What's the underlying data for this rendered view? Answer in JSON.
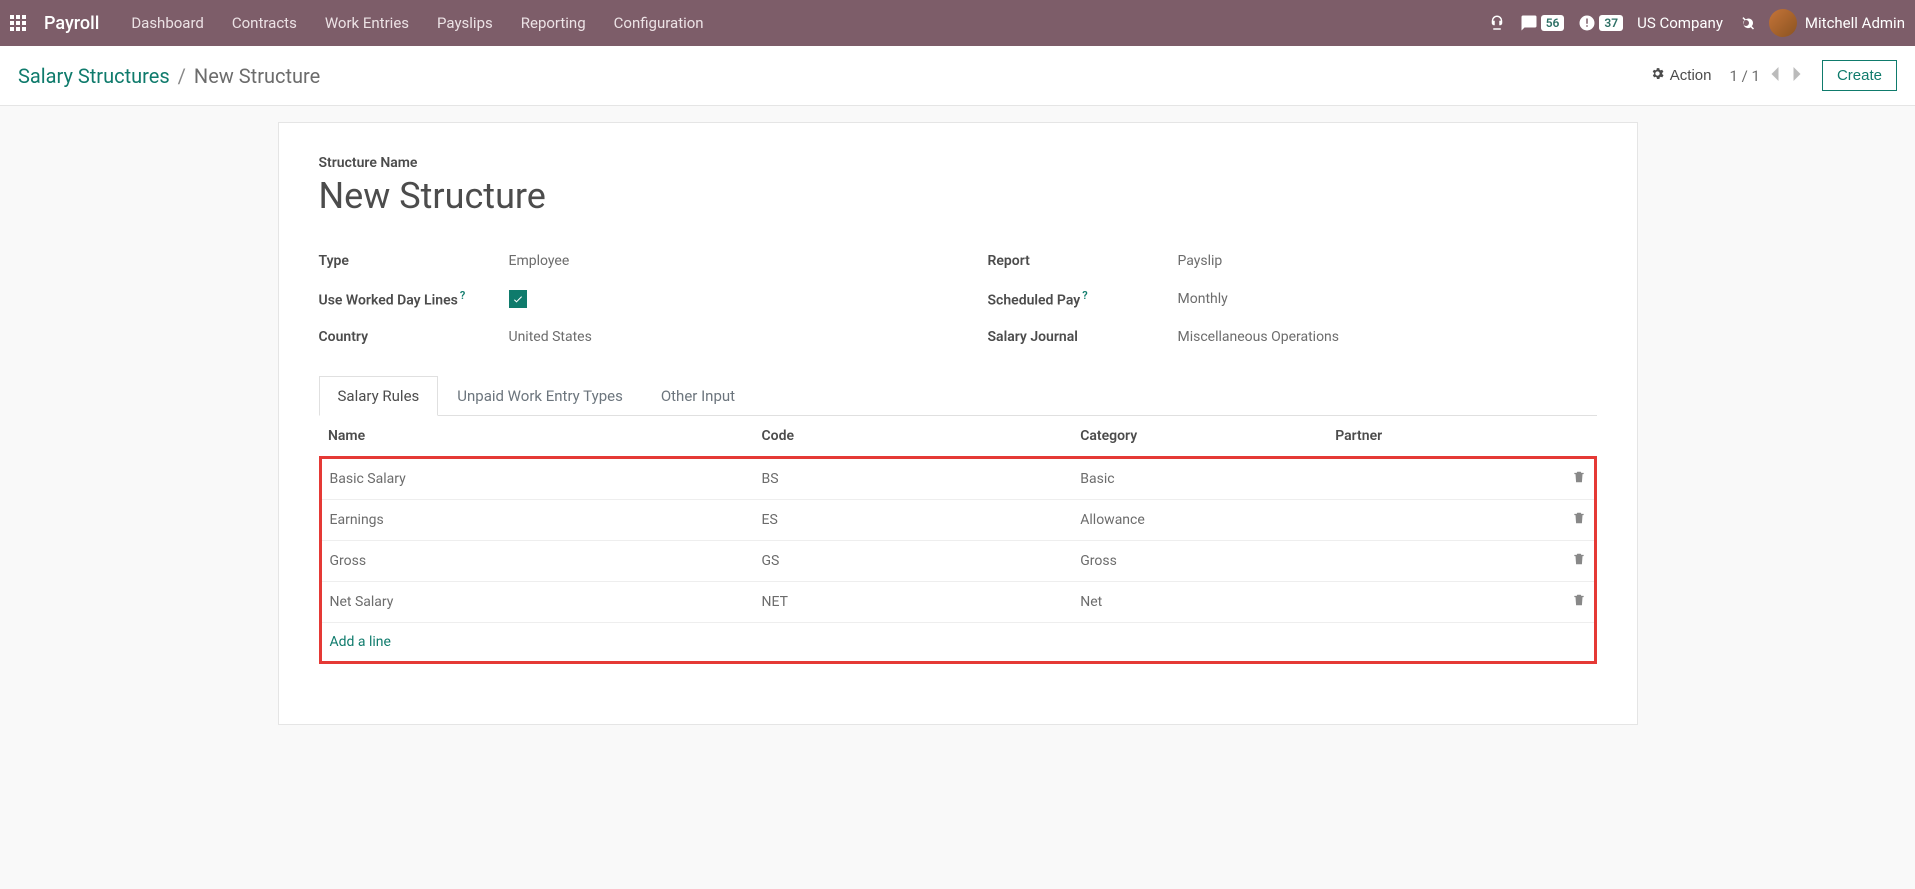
{
  "topnav": {
    "app_title": "Payroll",
    "items": [
      "Dashboard",
      "Contracts",
      "Work Entries",
      "Payslips",
      "Reporting",
      "Configuration"
    ],
    "discuss_count": "56",
    "activities_count": "37",
    "company": "US Company",
    "user_name": "Mitchell Admin"
  },
  "breadcrumb": {
    "root": "Salary Structures",
    "current": "New Structure"
  },
  "controlbar": {
    "action_label": "Action",
    "pager": "1 / 1",
    "create_label": "Create"
  },
  "form": {
    "name_label": "Structure Name",
    "name_value": "New Structure",
    "left_fields": [
      {
        "label": "Type",
        "value": "Employee",
        "help": false
      },
      {
        "label": "Use Worked Day Lines",
        "value": "checkbox",
        "help": true
      },
      {
        "label": "Country",
        "value": "United States",
        "help": false
      }
    ],
    "right_fields": [
      {
        "label": "Report",
        "value": "Payslip",
        "help": false
      },
      {
        "label": "Scheduled Pay",
        "value": "Monthly",
        "help": true
      },
      {
        "label": "Salary Journal",
        "value": "Miscellaneous Operations",
        "help": false
      }
    ]
  },
  "tabs": [
    "Salary Rules",
    "Unpaid Work Entry Types",
    "Other Input"
  ],
  "table": {
    "columns": [
      "Name",
      "Code",
      "Category",
      "Partner"
    ],
    "rows": [
      {
        "name": "Basic Salary",
        "code": "BS",
        "category": "Basic",
        "partner": ""
      },
      {
        "name": "Earnings",
        "code": "ES",
        "category": "Allowance",
        "partner": ""
      },
      {
        "name": "Gross",
        "code": "GS",
        "category": "Gross",
        "partner": ""
      },
      {
        "name": "Net Salary",
        "code": "NET",
        "category": "Net",
        "partner": ""
      }
    ],
    "add_line_label": "Add a line"
  }
}
